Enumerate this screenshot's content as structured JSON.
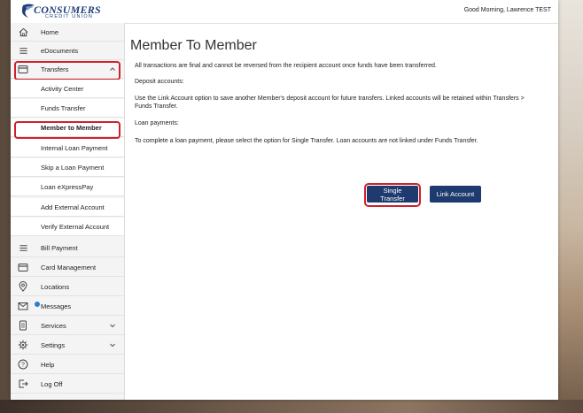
{
  "brand": {
    "name": "CONSUMERS",
    "tagline": "CREDIT UNION"
  },
  "header": {
    "greeting": "Good Morning, Lawrence TEST"
  },
  "sidebar": {
    "items": [
      {
        "label": "Home",
        "icon": "home-icon"
      },
      {
        "label": "eDocuments",
        "icon": "list-icon"
      },
      {
        "label": "Transfers",
        "icon": "card-icon"
      },
      {
        "label": "Activity Center"
      },
      {
        "label": "Funds Transfer"
      },
      {
        "label": "Member to Member"
      },
      {
        "label": "Internal Loan Payment"
      },
      {
        "label": "Skip a Loan Payment"
      },
      {
        "label": "Loan eXpressPay"
      },
      {
        "label": "Add External Account"
      },
      {
        "label": "Verify External Account"
      },
      {
        "label": "Bill Payment",
        "icon": "list-icon"
      },
      {
        "label": "Card Management",
        "icon": "card-icon"
      },
      {
        "label": "Locations",
        "icon": "location-pin-icon"
      },
      {
        "label": "Messages",
        "icon": "mail-icon"
      },
      {
        "label": "Services",
        "icon": "document-icon"
      },
      {
        "label": "Settings",
        "icon": "gear-icon"
      },
      {
        "label": "Help",
        "icon": "help-icon"
      },
      {
        "label": "Log Off",
        "icon": "logout-icon"
      }
    ]
  },
  "main": {
    "title": "Member To Member",
    "notice": "All transactions are final and cannot be reversed from the recipient account once funds have been transferred.",
    "deposit_heading": "Deposit accounts:",
    "deposit_text_1": "Use the Link Account option to save another Member's deposit account for future transfers. Linked accounts will be retained within Transfers >",
    "deposit_text_2": "Funds Transfer.",
    "loan_heading": "Loan payments:",
    "loan_text": "To complete a loan payment, please select the option for Single Transfer. Loan accounts are not linked under Funds Transfer.",
    "single_transfer_label": "Single Transfer",
    "link_account_label": "Link Account"
  },
  "colors": {
    "accent": "#1e3a6e",
    "highlight": "#d0212b"
  }
}
